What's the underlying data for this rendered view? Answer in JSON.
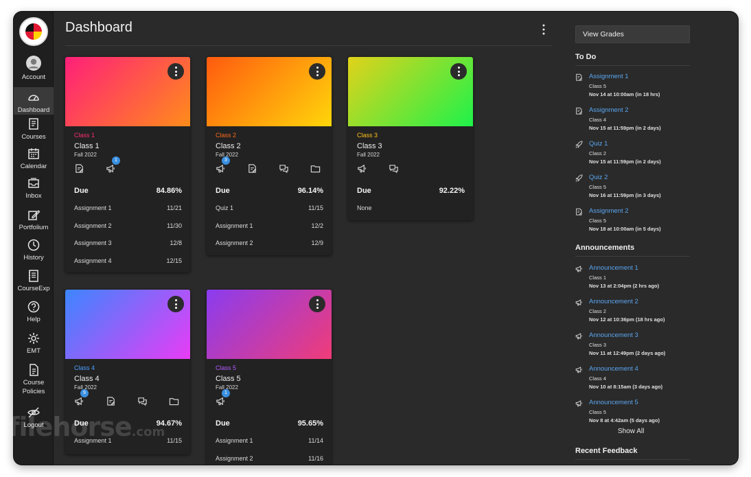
{
  "page": {
    "title": "Dashboard"
  },
  "sidebar": {
    "logo_text": "UNIVERSITY OF MARYLAND",
    "items": [
      {
        "label": "Account",
        "icon": "account-icon"
      },
      {
        "label": "Dashboard",
        "icon": "dashboard-icon",
        "active": true
      },
      {
        "label": "Courses",
        "icon": "courses-icon"
      },
      {
        "label": "Calendar",
        "icon": "calendar-icon"
      },
      {
        "label": "Inbox",
        "icon": "inbox-icon"
      },
      {
        "label": "Portfolium",
        "icon": "portfolium-icon"
      },
      {
        "label": "History",
        "icon": "history-icon"
      },
      {
        "label": "CourseExp",
        "icon": "courseexp-icon"
      },
      {
        "label": "Help",
        "icon": "help-icon"
      },
      {
        "label": "EMT",
        "icon": "gear-icon"
      },
      {
        "label": "Course Policies",
        "label_line1": "Course",
        "label_line2": "Policies",
        "icon": "document-icon"
      },
      {
        "label": "Logout",
        "icon": "eye-slash-icon"
      }
    ]
  },
  "cards": [
    {
      "code": "Class 1",
      "name": "Class 1",
      "term": "Fall 2022",
      "code_color": "#ff2d6e",
      "gradient": [
        "#ff1f7a",
        "#ff8c1a"
      ],
      "icons": [
        {
          "name": "assignments-icon"
        },
        {
          "name": "announcements-icon",
          "badge": "1"
        }
      ],
      "due_label": "Due",
      "grade": "84.86%",
      "items": [
        {
          "label": "Assignment 1",
          "date": "11/21"
        },
        {
          "label": "Assignment 2",
          "date": "11/30"
        },
        {
          "label": "Assignment 3",
          "date": "12/8"
        },
        {
          "label": "Assignment 4",
          "date": "12/15"
        }
      ]
    },
    {
      "code": "Class 2",
      "name": "Class 2",
      "term": "Fall 2022",
      "code_color": "#ff6a1a",
      "gradient": [
        "#ff5a0f",
        "#ffd60a"
      ],
      "icons": [
        {
          "name": "announcements-icon",
          "badge": "3"
        },
        {
          "name": "assignments-icon"
        },
        {
          "name": "discussions-icon"
        },
        {
          "name": "files-icon"
        }
      ],
      "due_label": "Due",
      "grade": "96.14%",
      "items": [
        {
          "label": "Quiz 1",
          "date": "11/15"
        },
        {
          "label": "Assignment 1",
          "date": "12/2"
        },
        {
          "label": "Assignment 2",
          "date": "12/9"
        }
      ]
    },
    {
      "code": "Class 3",
      "name": "Class 3",
      "term": "Fall 2022",
      "code_color": "#ffc21a",
      "gradient": [
        "#e2d21a",
        "#1ef24a"
      ],
      "icons": [
        {
          "name": "announcements-icon"
        },
        {
          "name": "discussions-icon"
        }
      ],
      "due_label": "Due",
      "grade": "92.22%",
      "items": [
        {
          "label": "None",
          "date": ""
        }
      ]
    },
    {
      "code": "Class 4",
      "name": "Class 4",
      "term": "Fall 2022",
      "code_color": "#4aa0ff",
      "gradient": [
        "#3c86ff",
        "#e83cf5"
      ],
      "icons": [
        {
          "name": "announcements-icon",
          "badge": "9"
        },
        {
          "name": "assignments-icon"
        },
        {
          "name": "discussions-icon"
        },
        {
          "name": "files-icon"
        }
      ],
      "due_label": "Due",
      "grade": "94.67%",
      "items": [
        {
          "label": "Assignment 1",
          "date": "11/15"
        }
      ]
    },
    {
      "code": "Class 5",
      "name": "Class 5",
      "term": "Fall 2022",
      "code_color": "#b45cff",
      "gradient": [
        "#8a3cf0",
        "#f03c78"
      ],
      "icons": [
        {
          "name": "announcements-icon",
          "badge": "1"
        }
      ],
      "due_label": "Due",
      "grade": "95.65%",
      "items": [
        {
          "label": "Assignment 1",
          "date": "11/14"
        },
        {
          "label": "Assignment 2",
          "date": "11/16"
        }
      ]
    }
  ],
  "right": {
    "view_grades": "View Grades",
    "todo_title": "To Do",
    "todo": [
      {
        "icon": "assignment-icon",
        "title": "Assignment 1",
        "course": "Class 5",
        "date": "Nov 14 at 10:00am (in 18 hrs)"
      },
      {
        "icon": "assignment-icon",
        "title": "Assignment 2",
        "course": "Class 4",
        "date": "Nov 15 at 11:59pm (in 2 days)"
      },
      {
        "icon": "rocket-icon",
        "title": "Quiz 1",
        "course": "Class 2",
        "date": "Nov 15 at 11:59pm (in 2 days)"
      },
      {
        "icon": "rocket-icon",
        "title": "Quiz 2",
        "course": "Class 5",
        "date": "Nov 16 at 11:59pm (in 3 days)"
      },
      {
        "icon": "assignment-icon",
        "title": "Assignment 2",
        "course": "Class 5",
        "date": "Nov 18 at 10:00am (in 5 days)"
      }
    ],
    "announcements_title": "Announcements",
    "announcements": [
      {
        "icon": "megaphone-icon",
        "title": "Announcement 1",
        "course": "Class 1",
        "date": "Nov 13 at 2:04pm (2 hrs ago)"
      },
      {
        "icon": "megaphone-icon",
        "title": "Announcement 2",
        "course": "Class 2",
        "date": "Nov 12 at 10:36pm (18 hrs ago)"
      },
      {
        "icon": "megaphone-icon",
        "title": "Announcement 3",
        "course": "Class 3",
        "date": "Nov 11 at 12:49pm (2 days ago)"
      },
      {
        "icon": "megaphone-icon",
        "title": "Announcement 4",
        "course": "Class 4",
        "date": "Nov 10 at 8:15am (3 days ago)"
      },
      {
        "icon": "megaphone-icon",
        "title": "Announcement 5",
        "course": "Class 5",
        "date": "Nov 8 at 4:42am (5 days ago)"
      }
    ],
    "show_all": "Show All",
    "feedback_title": "Recent Feedback"
  },
  "watermark": {
    "text": "filehorse",
    "suffix": ".com"
  }
}
